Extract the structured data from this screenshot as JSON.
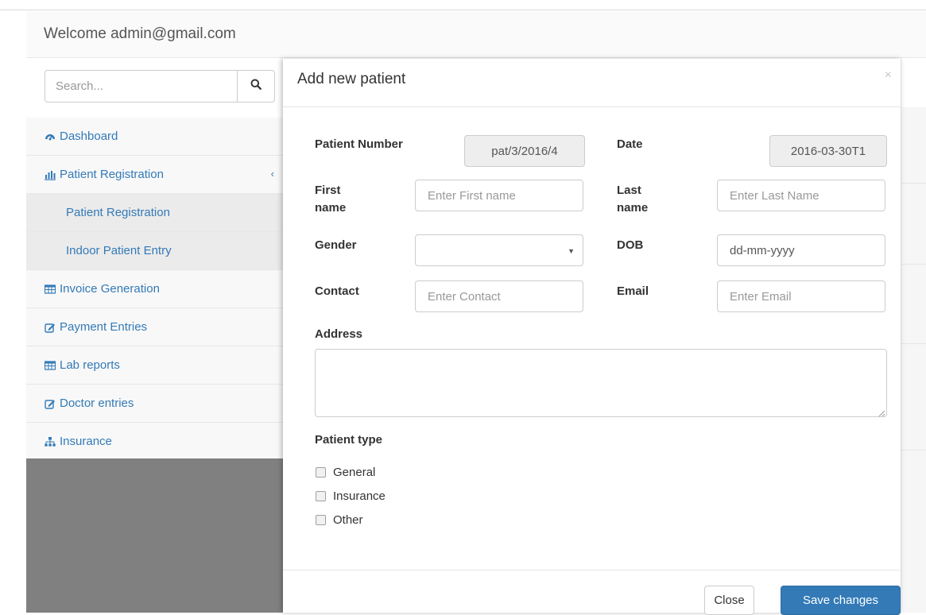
{
  "navbar": {
    "welcome_text": "Welcome admin@gmail.com"
  },
  "sidebar": {
    "search": {
      "placeholder": "Search..."
    },
    "items": [
      {
        "label": "Dashboard",
        "icon": "dashboard-icon"
      },
      {
        "label": "Patient Registration",
        "icon": "bar-chart-icon",
        "chevron": "‹"
      },
      {
        "label": "Patient Registration"
      },
      {
        "label": "Indoor Patient Entry"
      },
      {
        "label": "Invoice Generation",
        "icon": "table-icon"
      },
      {
        "label": "Payment Entries",
        "icon": "edit-icon"
      },
      {
        "label": "Lab reports",
        "icon": "table-icon"
      },
      {
        "label": "Doctor entries",
        "icon": "edit-icon"
      },
      {
        "label": "Insurance",
        "icon": "sitemap-icon"
      }
    ]
  },
  "modal": {
    "title": "Add new patient",
    "close_symbol": "×",
    "fields": {
      "patient_number": {
        "label": "Patient Number",
        "value": "pat/3/2016/4"
      },
      "date": {
        "label": "Date",
        "value": "2016-03-30T1"
      },
      "first_name": {
        "label_line1": "First",
        "label_line2": "name",
        "placeholder": "Enter First name"
      },
      "last_name": {
        "label_line1": "Last",
        "label_line2": "name",
        "placeholder": "Enter Last Name"
      },
      "gender": {
        "label": "Gender",
        "value": ""
      },
      "dob": {
        "label": "DOB",
        "value": "dd-mm-yyyy"
      },
      "contact": {
        "label": "Contact",
        "placeholder": "Enter Contact"
      },
      "email": {
        "label": "Email",
        "placeholder": "Enter Email"
      },
      "address": {
        "label": "Address",
        "value": ""
      }
    },
    "patient_type": {
      "label": "Patient type",
      "options": [
        "General",
        "Insurance",
        "Other"
      ]
    },
    "footer": {
      "close_label": "Close",
      "save_label": "Save changes"
    }
  },
  "colors": {
    "link": "#337ab7",
    "primary_button": "#337ab7",
    "backdrop_gray": "#808080"
  }
}
